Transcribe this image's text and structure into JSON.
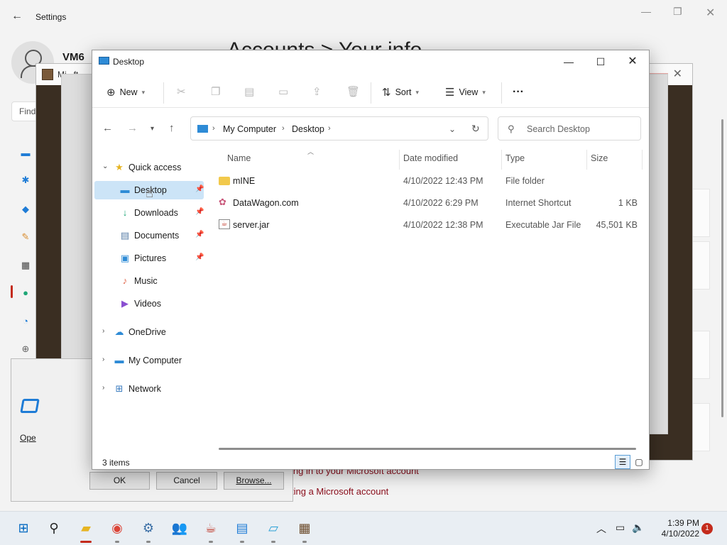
{
  "settings": {
    "title": "Settings",
    "user": "VM6",
    "heading": "Accounts  >  Your info",
    "find_placeholder": "Find",
    "links": [
      "ing in to your Microsoft account",
      "ting a Microsoft account"
    ]
  },
  "minecraft": {
    "title": "Mi...ft"
  },
  "run": {
    "open_label": "Ope",
    "ok": "OK",
    "cancel": "Cancel",
    "browse": "Browse..."
  },
  "explorer": {
    "title": "Desktop",
    "toolbar": {
      "new": "New",
      "sort": "Sort",
      "view": "View",
      "more": "···"
    },
    "address": {
      "root": "My Computer",
      "folder": "Desktop"
    },
    "search_placeholder": "Search Desktop",
    "nav": {
      "quick_access": "Quick access",
      "items": [
        {
          "label": "Desktop"
        },
        {
          "label": "Downloads"
        },
        {
          "label": "Documents"
        },
        {
          "label": "Pictures"
        },
        {
          "label": "Music"
        },
        {
          "label": "Videos"
        }
      ],
      "onedrive": "OneDrive",
      "my_computer": "My Computer",
      "network": "Network"
    },
    "columns": {
      "name": "Name",
      "date": "Date modified",
      "type": "Type",
      "size": "Size"
    },
    "files": [
      {
        "name": "mINE",
        "date": "4/10/2022 12:43 PM",
        "type": "File folder",
        "size": ""
      },
      {
        "name": "DataWagon.com",
        "date": "4/10/2022 6:29 PM",
        "type": "Internet Shortcut",
        "size": "1 KB"
      },
      {
        "name": "server.jar",
        "date": "4/10/2022 12:38 PM",
        "type": "Executable Jar File",
        "size": "45,501 KB"
      }
    ],
    "status": "3 items"
  },
  "taskbar": {
    "time": "1:39 PM",
    "date": "4/10/2022",
    "notifications": "1"
  },
  "colors": {
    "accent": "#0067c0",
    "selected": "#cce4f7",
    "badge": "#c42b1c"
  }
}
